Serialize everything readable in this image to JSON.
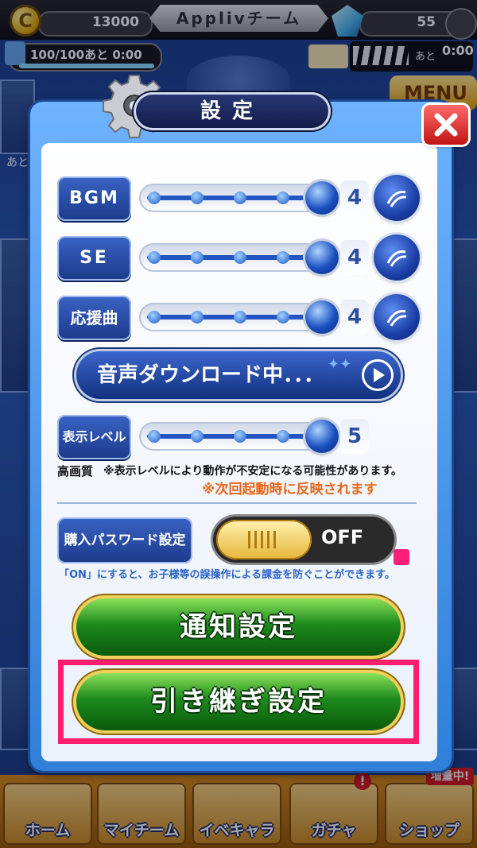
{
  "topbar": {
    "coin_icon_label": "C",
    "coins": "13000",
    "team_name": "Applivチーム",
    "gems": "55",
    "stamina": "100/100あと 0:00",
    "gauge_ato": "あと",
    "gauge_time": "0:00"
  },
  "background": {
    "menu_label": "MENU",
    "ato": "あと"
  },
  "dialog": {
    "title": "設定",
    "close_icon": "close-x-icon",
    "settings": [
      {
        "label": "BGM",
        "value": 4
      },
      {
        "label": "SE",
        "value": 4
      },
      {
        "label": "応援曲",
        "value": 4
      }
    ],
    "slider_max": 4,
    "download_label": "音声ダウンロード中．．．",
    "display_level": {
      "label": "表示レベル",
      "value": 5
    },
    "quality_label": "高画質",
    "quality_note": "※表示レベルにより動作が不安定になる可能性があります。",
    "restart_note": "※次回起動時に反映されます",
    "password_label": "購入パスワード設定",
    "password_toggle": "OFF",
    "password_note": "「ON」にすると、お子様等の誤操作による課金を防ぐことができます。",
    "notify_button": "通知設定",
    "transfer_button": "引き継ぎ設定"
  },
  "bottom_nav": {
    "items": [
      "ホーム",
      "マイチーム",
      "イベキャラ",
      "ガチャ",
      "ショップ"
    ],
    "alert_badge": "!",
    "zoryo_badge": "増量中!"
  },
  "colors": {
    "accent_blue": "#1b3a8a",
    "highlight": "#ff1e6e",
    "note_orange": "#e8651a",
    "green_button": "#1d8a1d"
  }
}
